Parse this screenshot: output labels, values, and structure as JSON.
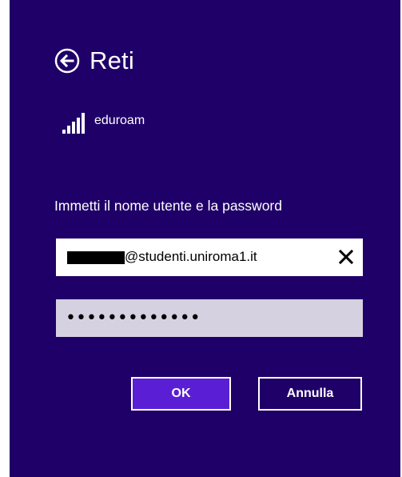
{
  "header": {
    "title": "Reti",
    "back_icon": "back-arrow-icon"
  },
  "network": {
    "icon": "wifi-signal-icon",
    "name": "eduroam"
  },
  "form": {
    "prompt": "Immetti il nome utente e la password",
    "username_value": "@studenti.uniroma1.it",
    "password_masked": "•••••••••••••",
    "clear_icon": "close-icon"
  },
  "buttons": {
    "ok_label": "OK",
    "cancel_label": "Annulla"
  },
  "colors": {
    "background": "#1f0068",
    "ok_button": "#5a1fd4",
    "password_field": "#d5d1e1"
  }
}
